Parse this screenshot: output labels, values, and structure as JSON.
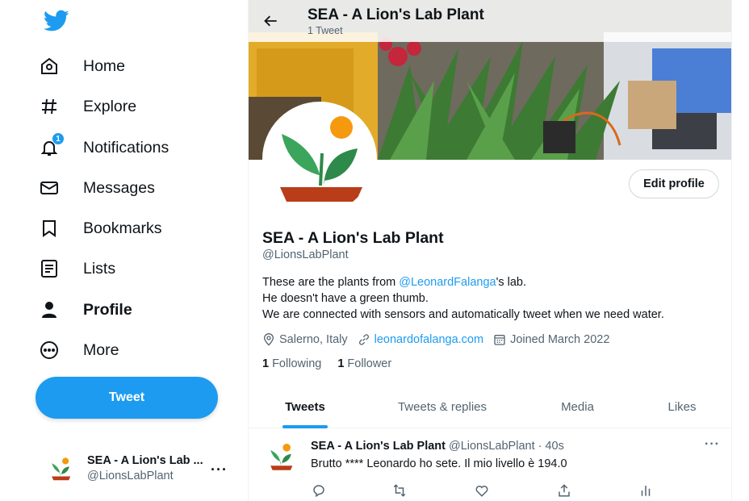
{
  "nav": {
    "items": [
      {
        "label": "Home",
        "icon": "home-icon"
      },
      {
        "label": "Explore",
        "icon": "hashtag-icon"
      },
      {
        "label": "Notifications",
        "icon": "bell-icon",
        "badge": "1"
      },
      {
        "label": "Messages",
        "icon": "envelope-icon"
      },
      {
        "label": "Bookmarks",
        "icon": "bookmark-icon"
      },
      {
        "label": "Lists",
        "icon": "list-icon"
      },
      {
        "label": "Profile",
        "icon": "person-icon",
        "active": true
      },
      {
        "label": "More",
        "icon": "more-circle-icon"
      }
    ],
    "tweet_button": "Tweet"
  },
  "account": {
    "name": "SEA - A Lion's Lab ...",
    "handle": "@LionsLabPlant",
    "more": "···"
  },
  "header": {
    "title": "SEA - A Lion's Lab Plant",
    "subtitle": "1 Tweet"
  },
  "profile": {
    "edit_button": "Edit profile",
    "name": "SEA - A Lion's Lab Plant",
    "handle": "@LionsLabPlant",
    "bio_line1_pre": "These are the plants from ",
    "bio_line1_mention": "@LeonardFalanga",
    "bio_line1_post": "'s lab.",
    "bio_line2": "He doesn't have a green thumb.",
    "bio_line3": "We are connected with sensors and automatically tweet when we need water.",
    "location": "Salerno, Italy",
    "website": "leonardofalanga.com",
    "joined": "Joined March 2022",
    "following_count": "1",
    "following_label": "Following",
    "followers_count": "1",
    "followers_label": "Follower"
  },
  "tabs": [
    "Tweets",
    "Tweets & replies",
    "Media",
    "Likes"
  ],
  "tweet": {
    "name": "SEA - A Lion's Lab Plant",
    "handle": "@LionsLabPlant · 40s",
    "text": "Brutto **** Leonardo ho sete. Il mio livello è 194.0",
    "more": "···"
  },
  "colors": {
    "accent": "#1d9bf0",
    "text": "#0f1419",
    "muted": "#536471",
    "plant_green": "#3aa55b",
    "pot_red": "#b83d18",
    "sun_orange": "#f59a0e"
  }
}
